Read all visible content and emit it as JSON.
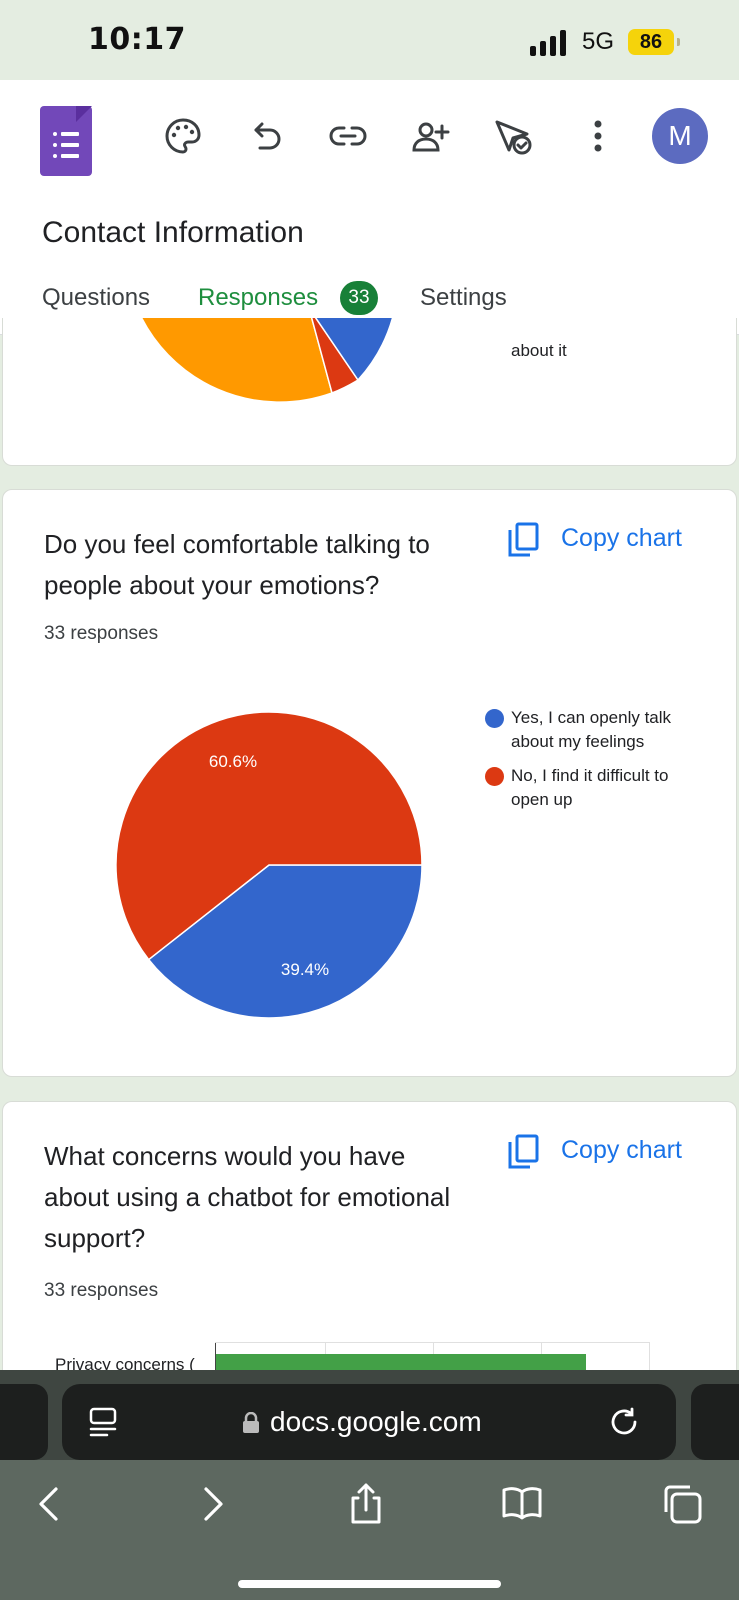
{
  "status_bar": {
    "time": "10:17",
    "network": "5G",
    "battery": "86"
  },
  "header": {
    "form_title": "Contact Information",
    "avatar_letter": "M",
    "tabs": {
      "questions": "Questions",
      "responses": "Responses",
      "responses_count": "33",
      "settings": "Settings"
    }
  },
  "prev_card": {
    "legend_fragment": "about it"
  },
  "question_2": {
    "title": "Do you feel comfortable talking to people about your emotions?",
    "response_count": "33 responses",
    "copy_label": "Copy chart",
    "legend": [
      {
        "label": "Yes, I can openly talk about my feelings",
        "color": "#3366cc"
      },
      {
        "label": "No, I find it difficult to open up",
        "color": "#dc3912"
      }
    ]
  },
  "question_3": {
    "title": "What concerns would you have about using a chatbot for emotional support?",
    "response_count": "33 responses",
    "copy_label": "Copy chart",
    "first_bar_label": "Privacy concerns ("
  },
  "chart_data": [
    {
      "type": "pie",
      "title": "Do you feel comfortable talking to people about your emotions?",
      "categories": [
        "Yes, I can openly talk about my feelings",
        "No, I find it difficult to open up"
      ],
      "values": [
        39.4,
        60.6
      ],
      "labels": [
        "39.4%",
        "60.6%"
      ],
      "colors": [
        "#3366cc",
        "#dc3912"
      ],
      "legend": "right"
    }
  ],
  "browser": {
    "url": "docs.google.com"
  }
}
